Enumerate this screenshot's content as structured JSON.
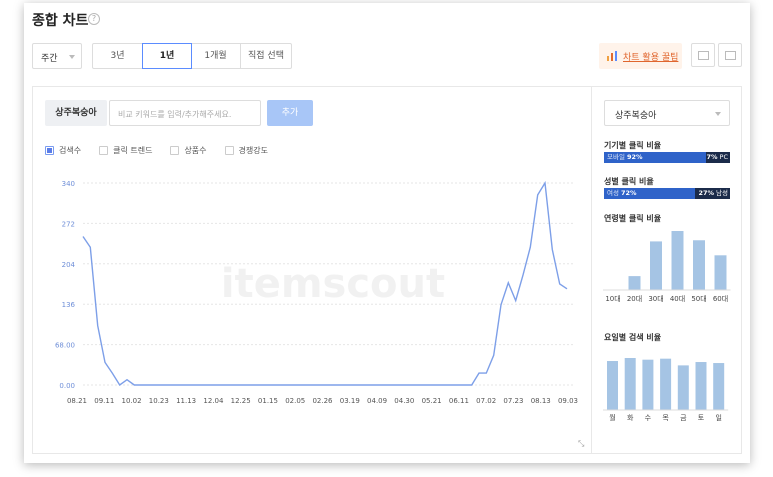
{
  "header": {
    "title": "종합 차트",
    "help": "?"
  },
  "controls": {
    "period": "주간",
    "ranges": [
      "3년",
      "1년",
      "1개월",
      "직접 선택"
    ],
    "active_range": 1,
    "tips_label": "차트 활용 꿀팁"
  },
  "keyword": {
    "chip": "상주복숭아",
    "input_placeholder": "비교 키워드를 입력/추가해주세요.",
    "add_label": "추가"
  },
  "legend": [
    {
      "label": "검색수",
      "checked": true
    },
    {
      "label": "클릭 트렌드",
      "checked": false
    },
    {
      "label": "상품수",
      "checked": false
    },
    {
      "label": "경쟁강도",
      "checked": false
    }
  ],
  "colors": {
    "line": "#7d9fe8",
    "bar": "#a5c4e4",
    "ratio_primary": "#2f63c9",
    "ratio_secondary": "#1b2b4a",
    "accent": "#e0662e"
  },
  "watermark": "itemscout",
  "chart_data": [
    {
      "type": "line",
      "ylim": [
        0,
        340
      ],
      "y_ticks": [
        "0.00",
        "68.00",
        "136",
        "204",
        "272",
        "340"
      ],
      "x_ticks": [
        "08.21",
        "09.11",
        "10.02",
        "10.23",
        "11.13",
        "12.04",
        "12.25",
        "01.15",
        "02.05",
        "02.26",
        "03.19",
        "04.09",
        "04.30",
        "05.21",
        "06.11",
        "07.02",
        "07.23",
        "08.13",
        "09.03"
      ],
      "series": [
        {
          "values": [
            250,
            232,
            100,
            38,
            20,
            0,
            9,
            0,
            0,
            0,
            0,
            0,
            0,
            0,
            0,
            0,
            0,
            0,
            0,
            0,
            0,
            0,
            0,
            0,
            0,
            0,
            0,
            0,
            0,
            0,
            0,
            0,
            0,
            0,
            0,
            0,
            0,
            0,
            0,
            0,
            0,
            0,
            0,
            0,
            0,
            0,
            0,
            0,
            0,
            0,
            0,
            0,
            0,
            0,
            20,
            20,
            50,
            135,
            172,
            142,
            185,
            232,
            320,
            340,
            228,
            170,
            162
          ]
        }
      ]
    },
    {
      "type": "bar",
      "title": "연령별 클릭 비율",
      "categories": [
        "10대",
        "20대",
        "30대",
        "40대",
        "50대",
        "60대"
      ],
      "values": [
        0,
        12,
        42,
        51,
        43,
        30
      ]
    },
    {
      "type": "bar",
      "title": "요일별 검색 비율",
      "categories": [
        "월",
        "화",
        "수",
        "목",
        "금",
        "토",
        "일"
      ],
      "values": [
        14.6,
        15.5,
        15.0,
        15.3,
        13.3,
        14.3,
        14.0
      ]
    }
  ],
  "device_ratio": {
    "title": "기기별 클릭 비율",
    "left_label": "모바일",
    "left_pct": "92%",
    "left_value": 92,
    "right_label": "PC",
    "right_pct": "7%"
  },
  "gender_ratio": {
    "title": "성별 클릭 비율",
    "left_label": "여성",
    "left_pct": "72%",
    "left_value": 72,
    "right_label": "남성",
    "right_pct": "27%"
  },
  "right_panel": {
    "select": "상주복숭아"
  }
}
